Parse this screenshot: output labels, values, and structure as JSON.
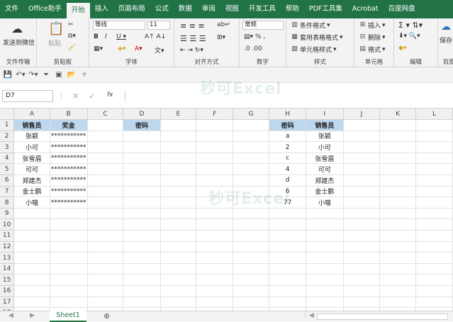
{
  "tabs": [
    "文件",
    "Office助手",
    "开始",
    "插入",
    "页面布局",
    "公式",
    "数据",
    "审阅",
    "视图",
    "开发工具",
    "帮助",
    "PDF工具集",
    "Acrobat",
    "百度网盘"
  ],
  "ribbon": {
    "wechat": "发送到微信",
    "paste": "粘贴",
    "font_name": "等线",
    "font_size": "11",
    "number_format": "常规",
    "cond_format": "条件格式",
    "table_format": "套用表格格式",
    "cell_style": "单元格样式",
    "insert": "插入",
    "delete": "删除",
    "format": "格式",
    "save_partial": "保存",
    "groups": {
      "wechat": "文件传输",
      "clipboard": "剪贴板",
      "font": "字体",
      "align": "对齐方式",
      "number": "数字",
      "styles": "样式",
      "cells": "单元格",
      "edit": "编辑",
      "save": "百度"
    }
  },
  "namebox": "D7",
  "watermark": "秒可Excel",
  "columns": [
    "A",
    "B",
    "C",
    "D",
    "E",
    "F",
    "G",
    "H",
    "I",
    "J",
    "K",
    "L"
  ],
  "rows": [
    [
      "销售员",
      "奖金",
      "",
      "密码",
      "",
      "",
      "",
      "密码",
      "销售员",
      "",
      "",
      ""
    ],
    [
      "张颖",
      "***********",
      "",
      "",
      "",
      "",
      "",
      "a",
      "张颖",
      "",
      "",
      ""
    ],
    [
      "小可",
      "***********",
      "",
      "",
      "",
      "",
      "",
      "2",
      "小可",
      "",
      "",
      ""
    ],
    [
      "张雪眉",
      "***********",
      "",
      "",
      "",
      "",
      "",
      "c",
      "张雪眉",
      "",
      "",
      ""
    ],
    [
      "可可",
      "***********",
      "",
      "",
      "",
      "",
      "",
      "4",
      "可可",
      "",
      "",
      ""
    ],
    [
      "郑建杰",
      "***********",
      "",
      "",
      "",
      "",
      "",
      "d",
      "郑建杰",
      "",
      "",
      ""
    ],
    [
      "金士鹏",
      "***********",
      "",
      "",
      "",
      "",
      "",
      "6",
      "金士鹏",
      "",
      "",
      ""
    ],
    [
      "小喵",
      "***********",
      "",
      "",
      "",
      "",
      "",
      "77",
      "小喵",
      "",
      "",
      ""
    ],
    [
      "",
      "",
      "",
      "",
      "",
      "",
      "",
      "",
      "",
      "",
      "",
      ""
    ],
    [
      "",
      "",
      "",
      "",
      "",
      "",
      "",
      "",
      "",
      "",
      "",
      ""
    ],
    [
      "",
      "",
      "",
      "",
      "",
      "",
      "",
      "",
      "",
      "",
      "",
      ""
    ],
    [
      "",
      "",
      "",
      "",
      "",
      "",
      "",
      "",
      "",
      "",
      "",
      ""
    ],
    [
      "",
      "",
      "",
      "",
      "",
      "",
      "",
      "",
      "",
      "",
      "",
      ""
    ],
    [
      "",
      "",
      "",
      "",
      "",
      "",
      "",
      "",
      "",
      "",
      "",
      ""
    ],
    [
      "",
      "",
      "",
      "",
      "",
      "",
      "",
      "",
      "",
      "",
      "",
      ""
    ],
    [
      "",
      "",
      "",
      "",
      "",
      "",
      "",
      "",
      "",
      "",
      "",
      ""
    ],
    [
      "",
      "",
      "",
      "",
      "",
      "",
      "",
      "",
      "",
      "",
      "",
      ""
    ],
    [
      "",
      "",
      "",
      "",
      "",
      "",
      "",
      "",
      "",
      "",
      "",
      ""
    ]
  ],
  "sheet": "Sheet1"
}
